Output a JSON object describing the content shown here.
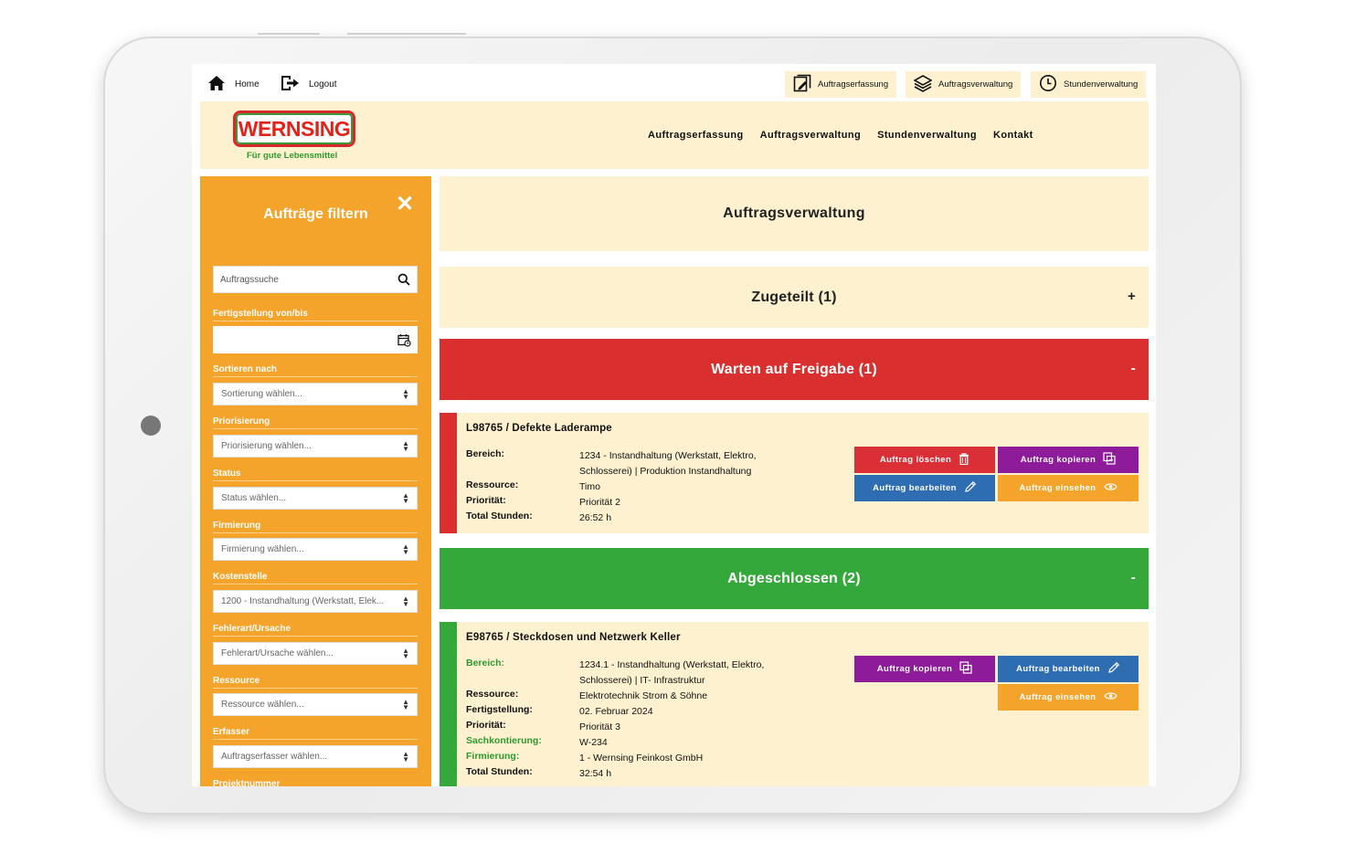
{
  "topbar": {
    "home_label": "Home",
    "logout_label": "Logout",
    "buttons": [
      {
        "label": "Auftragserfassung",
        "icon": "form-icon"
      },
      {
        "label": "Auftragsverwaltung",
        "icon": "layers-icon"
      },
      {
        "label": "Stundenverwaltung",
        "icon": "clock-icon"
      }
    ]
  },
  "header": {
    "logo_text": "WERNSING",
    "logo_subtitle": "Für gute Lebensmittel",
    "nav": [
      "Auftragserfassung",
      "Auftragsverwaltung",
      "Stundenverwaltung",
      "Kontakt"
    ]
  },
  "sidebar": {
    "title": "Aufträge filtern",
    "close_symbol": "✕",
    "search_placeholder": "Auftragssuche",
    "date_label": "Fertigstellung von/bis",
    "filters": [
      {
        "label": "Sortieren nach",
        "value": "Sortierung wählen..."
      },
      {
        "label": "Priorisierung",
        "value": "Priorisierung wählen..."
      },
      {
        "label": "Status",
        "value": "Status wählen..."
      },
      {
        "label": "Firmierung",
        "value": "Firmierung wählen..."
      },
      {
        "label": "Kostenstelle",
        "value": "1200 - Instandhaltung (Werkstatt, Elek..."
      },
      {
        "label": "Fehlerart/Ursache",
        "value": "Fehlerart/Ursache wählen..."
      },
      {
        "label": "Ressource",
        "value": "Ressource wählen..."
      },
      {
        "label": "Erfasser",
        "value": "Auftragserfasser wählen..."
      },
      {
        "label": "Projektnummer",
        "value": ""
      }
    ]
  },
  "main": {
    "title": "Auftragsverwaltung",
    "sections": [
      {
        "label": "Zugeteilt (1)",
        "toggle": "+",
        "color": "#fdf1d0"
      },
      {
        "label": "Warten auf Freigabe (1)",
        "toggle": "-",
        "color": "#d92f2f"
      },
      {
        "label": "Abgeschlossen (2)",
        "toggle": "-",
        "color": "#34a83a"
      }
    ],
    "card1": {
      "title": "L98765 / Defekte Laderampe",
      "rows": [
        {
          "key": "Bereich:",
          "value": "1234 - Instandhaltung (Werkstatt, Elektro, Schlosserei) | Produktion Instandhaltung"
        },
        {
          "key": "Ressource:",
          "value": "Timo"
        },
        {
          "key": "Priorität:",
          "value": "Priorität 2"
        },
        {
          "key": "Total Stunden:",
          "value": "26:52 h"
        }
      ],
      "buttons": {
        "delete": "Auftrag löschen",
        "copy": "Auftrag kopieren",
        "edit": "Auftrag bearbeiten",
        "view": "Auftrag einsehen"
      }
    },
    "card2": {
      "title": "E98765 / Steckdosen und Netzwerk Keller",
      "rows": [
        {
          "key": "Bereich:",
          "value": "1234.1 - Instandhaltung (Werkstatt, Elektro, Schlosserei) | IT- Infrastruktur"
        },
        {
          "key": "Ressource:",
          "value": "Elektrotechnik Strom & Söhne"
        },
        {
          "key": "Fertigstellung:",
          "value": "02. Februar 2024"
        },
        {
          "key": "Priorität:",
          "value": "Priorität 3"
        },
        {
          "key": "Sachkontierung:",
          "value": "W-234"
        },
        {
          "key": "Firmierung:",
          "value": "1 - Wernsing Feinkost GmbH"
        },
        {
          "key": "Total Stunden:",
          "value": "32:54 h"
        }
      ],
      "buttons": {
        "copy": "Auftrag kopieren",
        "edit": "Auftrag bearbeiten",
        "view": "Auftrag einsehen"
      }
    }
  },
  "colors": {
    "orange": "#f4a42a",
    "cream": "#fdf1d0",
    "red": "#d92f2f",
    "green": "#34a83a",
    "purple": "#8e1b9a",
    "blue": "#2f6db3",
    "button_red": "#db2f37",
    "button_orange": "#f4a42a"
  }
}
